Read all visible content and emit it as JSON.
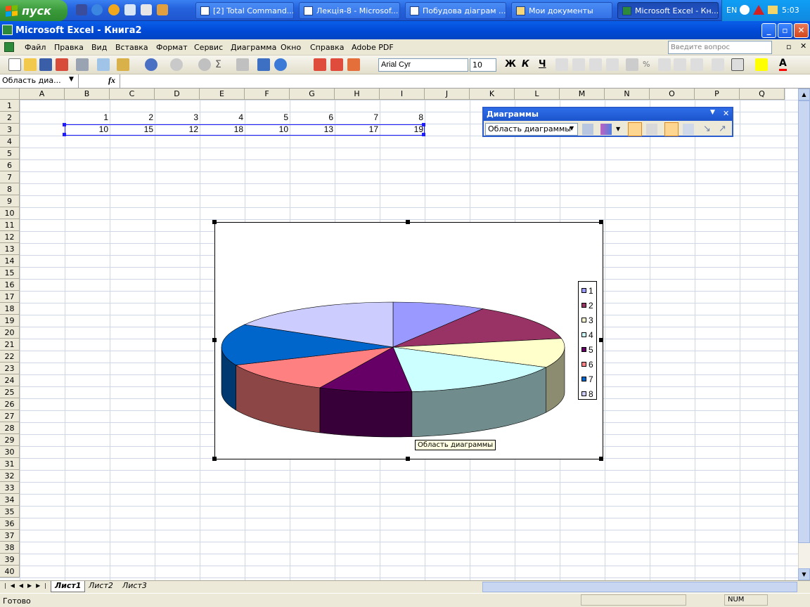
{
  "taskbar": {
    "start_label": "пуск",
    "tasks": [
      {
        "label": "[2] Total Command..."
      },
      {
        "label": "Лекція-8 - Microsof..."
      },
      {
        "label": "Побудова діаграм ..."
      },
      {
        "label": "Мои документы"
      },
      {
        "label": "Microsoft Excel - Кн..."
      }
    ],
    "lang": "EN",
    "clock": "5:03"
  },
  "window": {
    "title": "Microsoft Excel - Книга2"
  },
  "menu": {
    "items": [
      "Файл",
      "Правка",
      "Вид",
      "Вставка",
      "Формат",
      "Сервис",
      "Диаграмма",
      "Окно",
      "Справка",
      "Adobe PDF"
    ],
    "help_placeholder": "Введите вопрос"
  },
  "toolbar": {
    "font_name": "Arial Cyr",
    "font_size": "10",
    "bold": "Ж",
    "italic": "К",
    "underline": "Ч"
  },
  "formula_bar": {
    "name_box": "Область диа...",
    "fx": "fx",
    "value": ""
  },
  "sheet": {
    "columns": [
      "A",
      "B",
      "C",
      "D",
      "E",
      "F",
      "G",
      "H",
      "I",
      "J",
      "K",
      "L",
      "M",
      "N",
      "O",
      "P",
      "Q"
    ],
    "rows": [
      "1",
      "2",
      "3",
      "4",
      "5",
      "6",
      "7",
      "8",
      "9",
      "10",
      "11",
      "12",
      "13",
      "14",
      "15",
      "16",
      "17",
      "18",
      "19",
      "20",
      "21",
      "22",
      "23",
      "24",
      "25",
      "26",
      "27",
      "28",
      "29",
      "30",
      "31",
      "32",
      "33",
      "34",
      "35",
      "36",
      "37",
      "38",
      "39",
      "40"
    ],
    "row2": [
      "1",
      "2",
      "3",
      "4",
      "5",
      "6",
      "7",
      "8"
    ],
    "row3": [
      "10",
      "15",
      "12",
      "18",
      "10",
      "13",
      "17",
      "19"
    ]
  },
  "chart_toolbar": {
    "title": "Диаграммы",
    "object_select": "Область диаграммы"
  },
  "chart_tooltip": "Область диаграммы",
  "chart_data": {
    "type": "pie",
    "categories": [
      "1",
      "2",
      "3",
      "4",
      "5",
      "6",
      "7",
      "8"
    ],
    "values": [
      10,
      15,
      12,
      18,
      10,
      13,
      17,
      19
    ],
    "colors": [
      "#9999ff",
      "#993366",
      "#ffffcc",
      "#ccffff",
      "#660066",
      "#ff8080",
      "#0066cc",
      "#ccccff"
    ],
    "legend": "right"
  },
  "sheet_tabs": [
    "Лист1",
    "Лист2",
    "Лист3"
  ],
  "status": {
    "left": "Готово",
    "num": "NUM"
  }
}
